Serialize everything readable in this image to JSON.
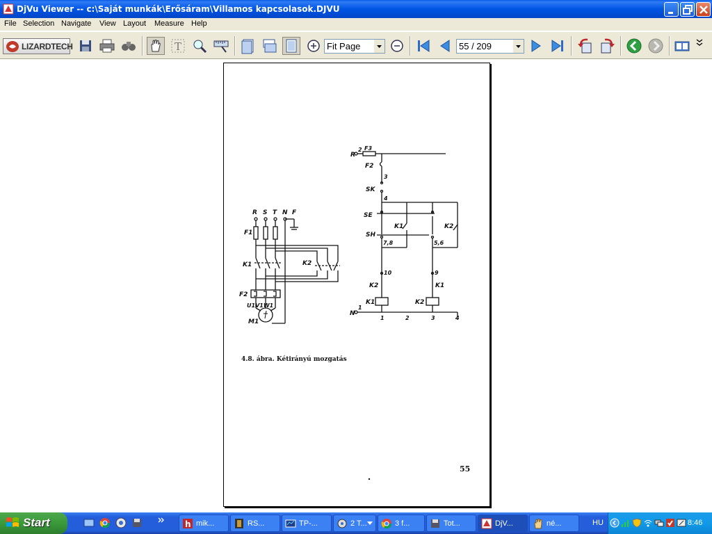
{
  "window": {
    "title": "DjVu Viewer -- c:\\Saját munkák\\Erősáram\\Villamos kapcsolasok.DJVU"
  },
  "menu": [
    "File",
    "Selection",
    "Navigate",
    "View",
    "Layout",
    "Measure",
    "Help"
  ],
  "toolbar": {
    "logo_text": "LIZARDTECH",
    "zoom_value": "Fit Page",
    "page_value": "55 / 209"
  },
  "document": {
    "caption": "4.8. ábra. Kétirányú mozgatás",
    "page_number": "55",
    "schematic_labels": {
      "R": "R",
      "S": "S",
      "T": "T",
      "N_top": "N",
      "F": "F",
      "F1": "F1",
      "K1_left": "K1",
      "K2_left": "K2",
      "F2_left": "F2",
      "U1V1W1": "U1V1W1",
      "M1": "M1",
      "R_ctrl": "R",
      "two": "2",
      "F3": "F3",
      "F2_ctrl": "F2",
      "n3": "3",
      "SK": "SK",
      "n4": "4",
      "SE": "SE",
      "K1_c": "K1",
      "K2_c": "K2",
      "SH": "SH",
      "n78": "7,8",
      "n56": "5,6",
      "n10": "10",
      "n9": "9",
      "K2_c2": "K2",
      "K1_c2": "K1",
      "K1_coil": "K1",
      "K2_coil": "K2",
      "N_ctrl": "N",
      "n1": "1",
      "b1": "1",
      "b2": "2",
      "b3": "3",
      "b4": "4"
    }
  },
  "taskbar": {
    "start": "Start",
    "tasks": [
      "mik...",
      "RS...",
      "TP-...",
      "2 T...",
      "3 f...",
      "Tot...",
      "DjV...",
      "né..."
    ],
    "lang": "HU",
    "clock": "8:46"
  },
  "colors": {
    "title_bar": "#0054e3",
    "chrome": "#ece9d8",
    "taskbar": "#245edb",
    "start_button": "#3a9a3a"
  }
}
